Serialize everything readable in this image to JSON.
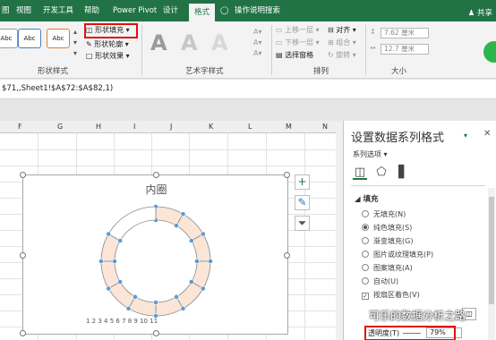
{
  "tabs": [
    {
      "label": "图"
    },
    {
      "label": "视图"
    },
    {
      "label": "开发工具"
    },
    {
      "label": "帮助"
    },
    {
      "label": "Power Pivot"
    },
    {
      "label": "设计"
    },
    {
      "label": "格式",
      "active": true
    },
    {
      "label": "操作说明搜索"
    }
  ],
  "share_label": "共享",
  "ribbon": {
    "shape_style_samples": [
      "Abc",
      "Abc",
      "Abc"
    ],
    "shape_fill": "形状填充",
    "shape_outline": "形状轮廓",
    "shape_effects": "形状效果",
    "shape_styles_group": "形状样式",
    "wordart_letter": "A",
    "wordart_group": "艺术字样式",
    "bring_forward": "上移一层",
    "send_backward": "下移一层",
    "selection_pane": "选择窗格",
    "align": "对齐",
    "group": "组合",
    "rotate": "旋转",
    "arrange_group": "排列",
    "height_value": "7.62 厘米",
    "width_value": "12.7 厘米",
    "size_group": "大小"
  },
  "formula_text": "$71,,Sheet1!$A$72:$A$82,1)",
  "columns": [
    "F",
    "G",
    "H",
    "I",
    "J",
    "K",
    "L",
    "M",
    "N"
  ],
  "chart": {
    "title": "内圈",
    "legend": "1 2 3 4 5 6 7 8 9 10 11",
    "colors": {
      "segment_fill": "#fbe5d6",
      "segment_stroke": "#8a8a8a",
      "handle": "#5b9bd5"
    }
  },
  "chart_buttons": [
    {
      "icon": "plus-icon",
      "glyph": "+"
    },
    {
      "icon": "brush-icon",
      "glyph": "✎"
    },
    {
      "icon": "filter-icon",
      "glyph": "⏷"
    }
  ],
  "pane": {
    "title": "设置数据系列格式",
    "series_options": "系列选项",
    "section_fill": "填充",
    "options": [
      {
        "label": "无填充(N)",
        "type": "radio",
        "selected": false
      },
      {
        "label": "纯色填充(S)",
        "type": "radio",
        "selected": true
      },
      {
        "label": "渐变填充(G)",
        "type": "radio",
        "selected": false
      },
      {
        "label": "图片或纹理填充(P)",
        "type": "radio",
        "selected": false
      },
      {
        "label": "图案填充(A)",
        "type": "radio",
        "selected": false
      },
      {
        "label": "自动(U)",
        "type": "radio",
        "selected": false
      },
      {
        "label": "按扇区着色(V)",
        "type": "check",
        "selected": true
      }
    ],
    "transparency_label": "透明度(T)",
    "transparency_value": "79%",
    "watermark": "可乐的数据分析之路"
  }
}
